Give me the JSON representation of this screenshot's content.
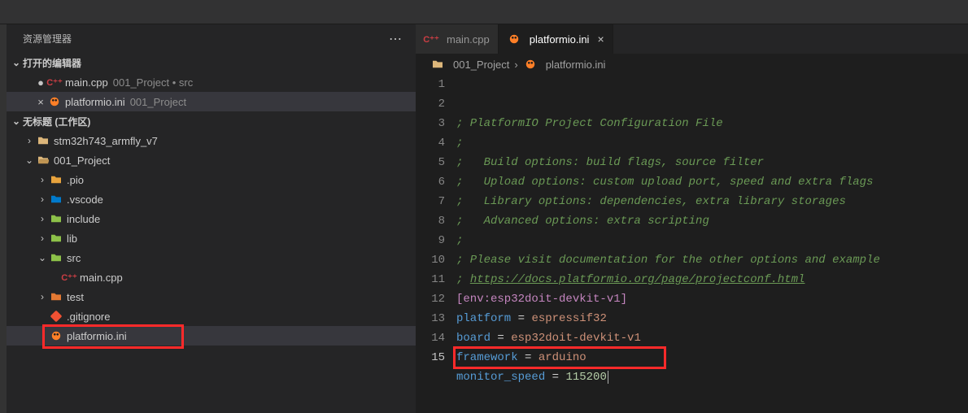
{
  "sidebar": {
    "title": "资源管理器",
    "open_editors_label": "打开的编辑器",
    "open_editors": [
      {
        "icon": "cpp",
        "name": "main.cpp",
        "path": "001_Project • src",
        "dirty": true
      },
      {
        "icon": "pio",
        "name": "platformio.ini",
        "path": "001_Project",
        "dirty": false,
        "active": true
      }
    ],
    "workspace_label": "无标题 (工作区)",
    "tree": {
      "proj1": {
        "name": "stm32h743_armfly_v7"
      },
      "proj2": {
        "name": "001_Project"
      },
      "folders": {
        "pio": ".pio",
        "vscode": ".vscode",
        "include": "include",
        "lib": "lib",
        "src": "src",
        "test": "test"
      },
      "files": {
        "maincpp": "main.cpp",
        "gitignore": ".gitignore",
        "pioini": "platformio.ini"
      }
    }
  },
  "tabs": [
    {
      "icon": "cpp",
      "name": "main.cpp",
      "active": false
    },
    {
      "icon": "pio",
      "name": "platformio.ini",
      "active": true
    }
  ],
  "breadcrumb": {
    "folder": "001_Project",
    "file": "platformio.ini"
  },
  "code": {
    "lines": [
      "; PlatformIO Project Configuration File",
      ";",
      ";   Build options: build flags, source filter",
      ";   Upload options: custom upload port, speed and extra flags",
      ";   Library options: dependencies, extra library storages",
      ";   Advanced options: extra scripting",
      ";",
      "; Please visit documentation for the other options and example"
    ],
    "link_prefix": "; ",
    "link": "https://docs.platformio.org/page/projectconf.html",
    "section": "[env:esp32doit-devkit-v1]",
    "kv": [
      {
        "k": "platform",
        "v": "espressif32"
      },
      {
        "k": "board",
        "v": "esp32doit-devkit-v1"
      },
      {
        "k": "framework",
        "v": "arduino"
      }
    ],
    "lastk": "monitor_speed",
    "lastv": "115200"
  }
}
